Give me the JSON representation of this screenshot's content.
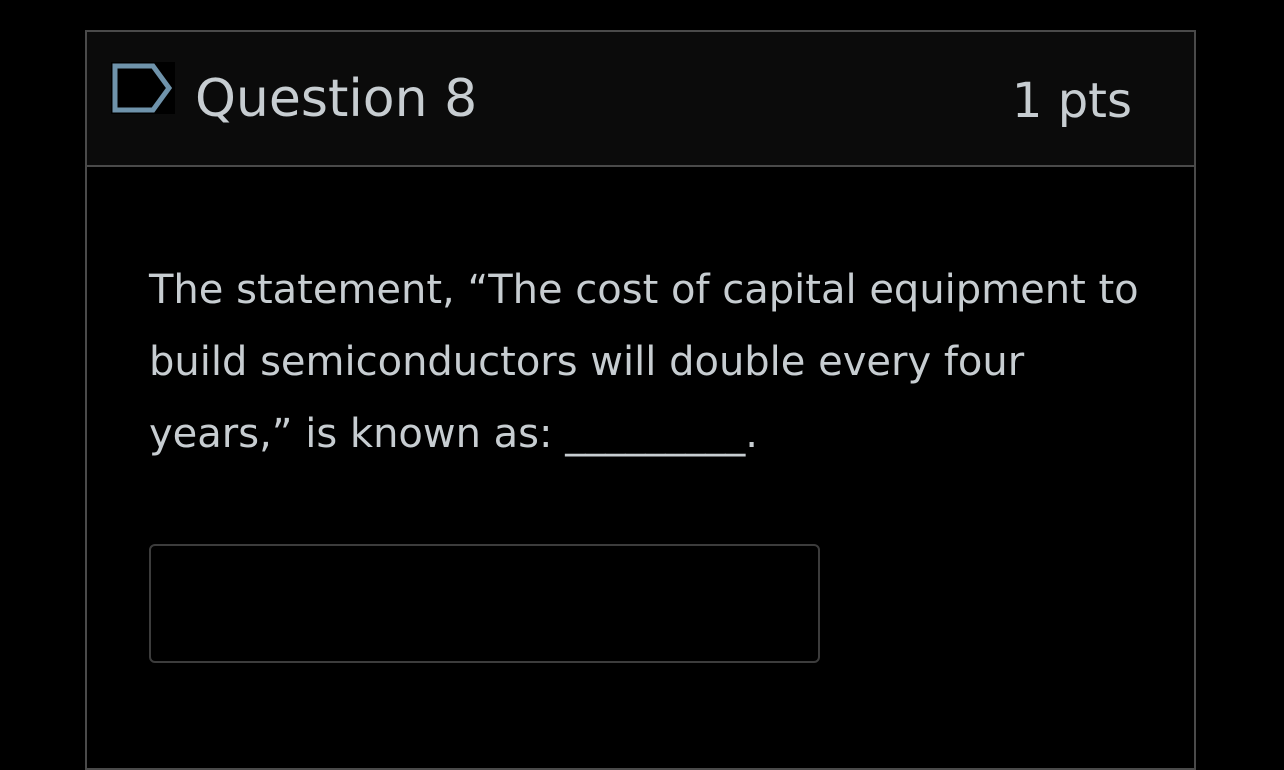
{
  "question": {
    "title": "Question 8",
    "points": "1 pts",
    "flag_icon": "flag-icon",
    "text": "The statement, “The cost of capital equipment to build semiconductors will double every four years,” is known as: _________.",
    "answer_value": "",
    "answer_placeholder": ""
  },
  "colors": {
    "background": "#000000",
    "header_background": "#0b0b0b",
    "border": "#4a4a4a",
    "text": "#c7cdd1",
    "flag_outline": "#6f93ab"
  }
}
